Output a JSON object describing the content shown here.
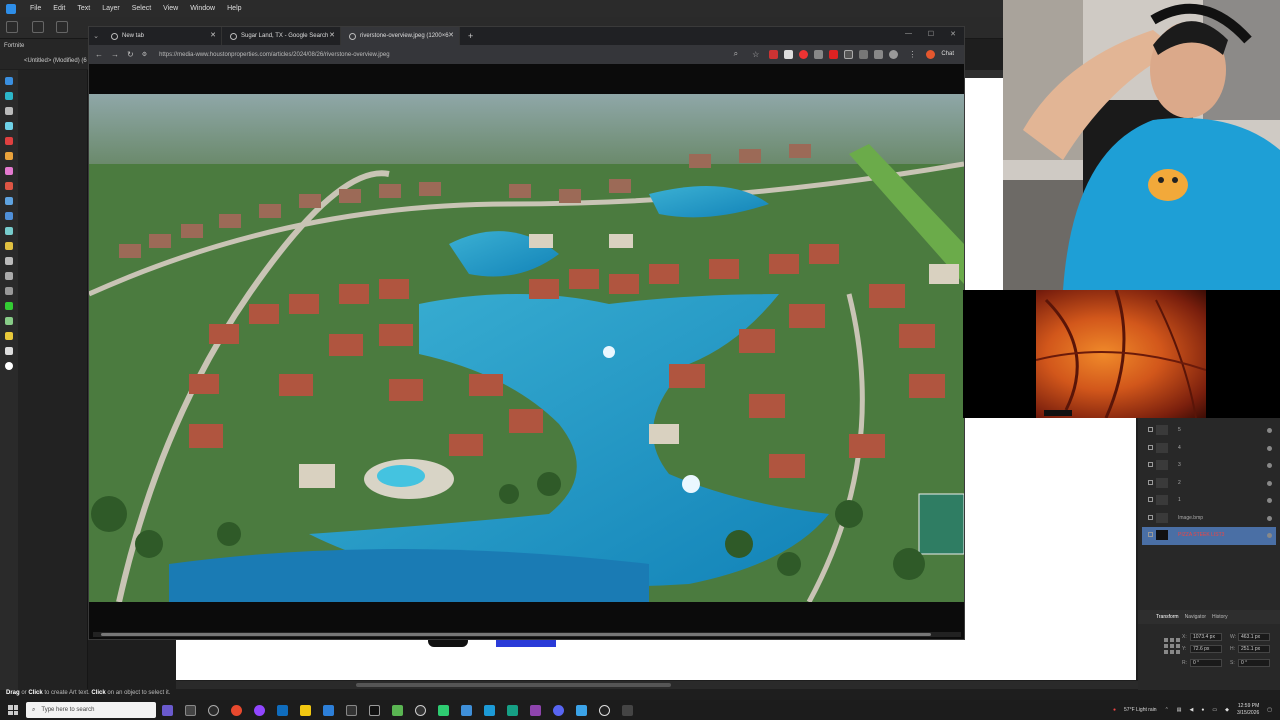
{
  "app": {
    "menu": [
      "File",
      "Edit",
      "Text",
      "Layer",
      "Select",
      "View",
      "Window",
      "Help"
    ],
    "document_name": "<Untitled> (Modified) (6",
    "font_field": "Fortnite",
    "status_hint_prefix": "Drag",
    "status_hint_text1": " or ",
    "status_hint_click1": "Click",
    "status_hint_text2": " to create Art text. ",
    "status_hint_click2": "Click",
    "status_hint_text3": " on an object to select it."
  },
  "browser": {
    "tabs": [
      {
        "label": "New tab"
      },
      {
        "label": "Sugar Land, TX - Google Search"
      },
      {
        "label": "riverstone-overview.jpeg (1200×6"
      }
    ],
    "active_tab": 2,
    "url": "https://media-www.houstonproperties.com/articles/2024/08/26/riverstone-overview.jpeg",
    "chat_label": "Chat"
  },
  "layers_panel": {
    "layers": [
      {
        "name": "5"
      },
      {
        "name": "4"
      },
      {
        "name": "3"
      },
      {
        "name": "2"
      },
      {
        "name": "1"
      },
      {
        "name": "Image.bmp"
      },
      {
        "name": "PIZZA STEEK LIST3"
      }
    ],
    "selected_index": 6
  },
  "panel_tabs": [
    "Transform",
    "Navigator",
    "History"
  ],
  "transform": {
    "x_label": "X:",
    "x": "1073.4 px",
    "y_label": "Y:",
    "y": "72.6 px",
    "w_label": "W:",
    "w": "463.1 px",
    "h_label": "H:",
    "h": "251.1 px",
    "r_label": "R:",
    "r": "0 °",
    "s_label": "S:",
    "s": "0 °"
  },
  "taskbar": {
    "search_placeholder": "Type here to search",
    "weather": "57°F  Light rain",
    "time": "12:59 PM",
    "date": "3/15/2026"
  },
  "colors": {
    "menubar": "#2b2b2b",
    "accent": "#2e8ee8",
    "selected_layer": "#4a6fa5",
    "webcam_shirt": "#1e9fd6"
  }
}
